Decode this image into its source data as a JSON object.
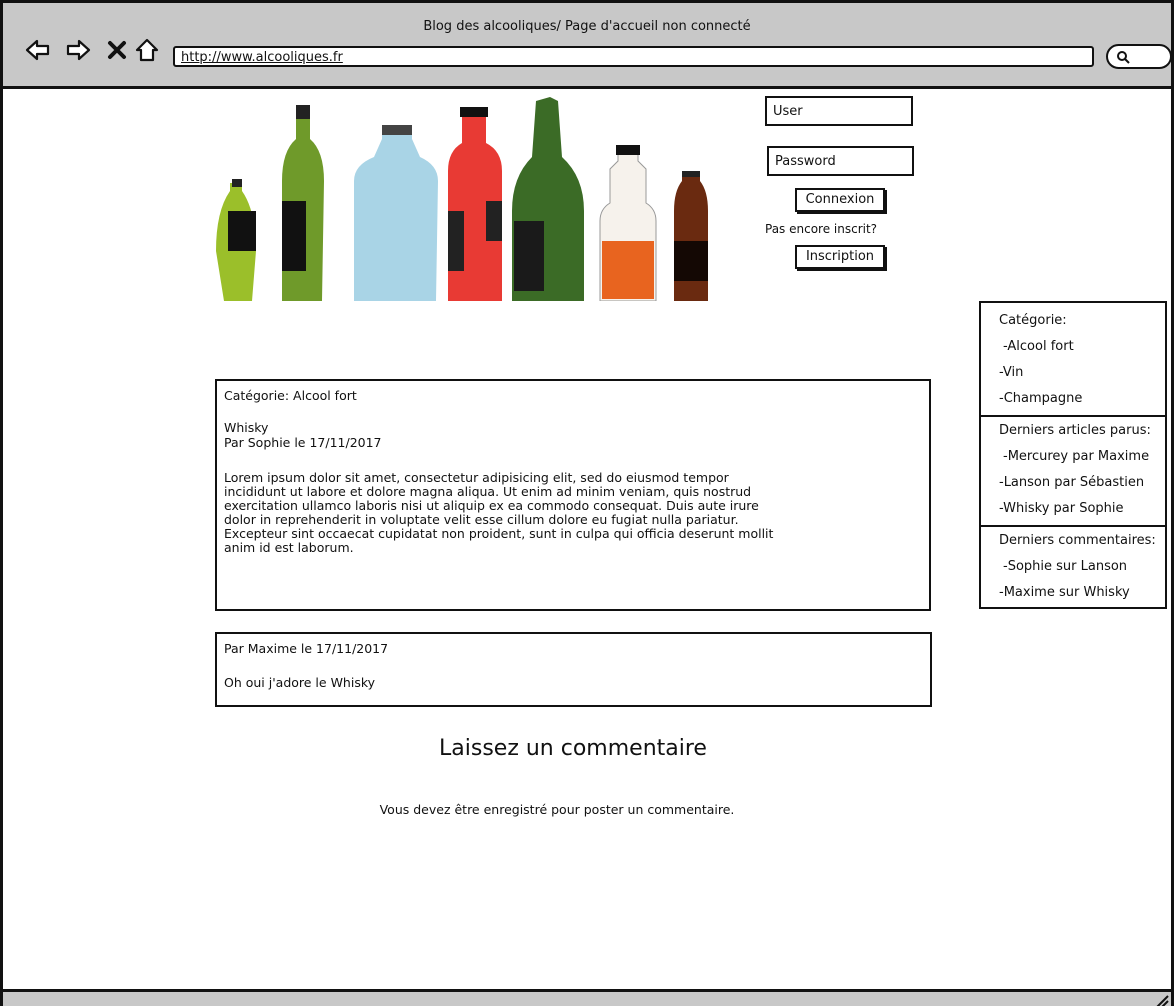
{
  "window": {
    "title": "Blog des alcooliques/ Page d'accueil non connecté",
    "url": "http://www.alcooliques.fr"
  },
  "nav": {
    "icons": [
      "back-arrow-icon",
      "forward-arrow-icon",
      "close-icon",
      "home-icon",
      "search-icon"
    ]
  },
  "login": {
    "user_placeholder": "User",
    "password_placeholder": "Password",
    "login_label": "Connexion",
    "not_registered": "Pas encore inscrit?",
    "register_label": "Inscription"
  },
  "sidebar": {
    "categories_title": "Catégorie:",
    "categories": [
      "-Alcool fort",
      "-Vin",
      "-Champagne"
    ],
    "latest_articles_title": "Derniers articles parus:",
    "latest_articles": [
      "-Mercurey par Maxime",
      "-Lanson par Sébastien",
      "-Whisky par Sophie"
    ],
    "latest_comments_title": "Derniers commentaires:",
    "latest_comments": [
      "-Sophie sur Lanson",
      "-Maxime sur Whisky"
    ]
  },
  "article": {
    "category": "Catégorie: Alcool fort",
    "title": "Whisky",
    "byline": "Par Sophie le 17/11/2017",
    "body": "Lorem ipsum dolor sit amet, consectetur adipisicing elit, sed do eiusmod tempor incididunt ut labore et dolore magna aliqua. Ut enim ad minim veniam, quis nostrud exercitation ullamco laboris nisi ut aliquip ex ea commodo consequat. Duis aute irure dolor in reprehenderit in voluptate velit esse cillum dolore eu fugiat nulla pariatur. Excepteur sint occaecat cupidatat non proident, sunt in culpa qui officia deserunt mollit anim id est laborum."
  },
  "comment": {
    "byline": "Par Maxime le 17/11/2017",
    "text": "Oh oui j'adore le Whisky"
  },
  "leave_comment": {
    "title": "Laissez un commentaire",
    "notice": "Vous devez être enregistré pour poster un commentaire."
  },
  "colors": {
    "chrome": "#c8c8c8",
    "border": "#111111"
  }
}
